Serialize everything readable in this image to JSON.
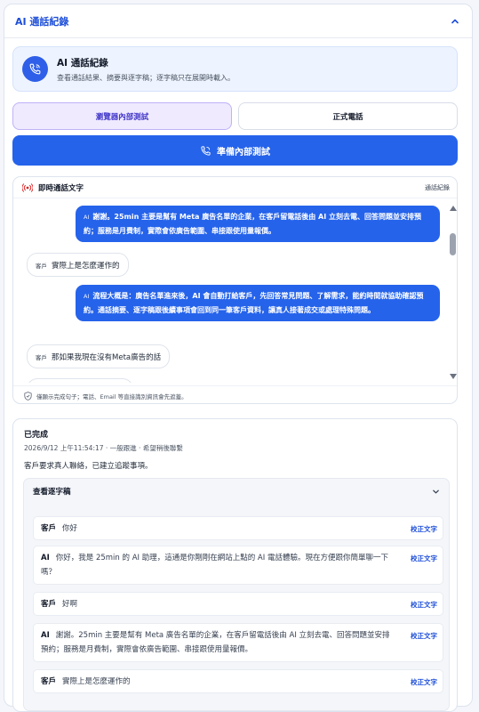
{
  "panel": {
    "title": "AI 通話紀錄"
  },
  "info": {
    "title": "AI 通話紀錄",
    "subtitle": "查看通話結果、摘要與逐字稿；逐字稿只在展開時載入。"
  },
  "modes": {
    "browser": "瀏覽器內部測試",
    "phone": "正式電話"
  },
  "primary_button": "準備內部測試",
  "live": {
    "title": "即時通話文字",
    "link": "通話紀錄",
    "footer": "僅顯示完成句子；電話、Email 等直接識別資訊會先遮蓋。",
    "messages": [
      {
        "role": "ai",
        "tag": "AI",
        "text": "謝謝。25min 主要是幫有 Meta 廣告名單的企業，在客戶留電話後由 AI 立刻去電、回答問題並安排預約；服務是月費制，實際會依廣告範圍、串接跟使用量報價。"
      },
      {
        "role": "user",
        "tag": "客戶",
        "text": "實際上是怎麼運作的"
      },
      {
        "role": "ai",
        "tag": "AI",
        "text": "流程大概是：廣告名單進來後，AI 會自動打給客戶，先回答常見問題、了解需求，能約時間就協助確認預約。通話摘要、逐字稿跟後續事項會回到同一筆客戶資料，讓真人接著成交或處理特殊問題。"
      },
      {
        "role": "user",
        "tag": "客戶",
        "text": "那如果我現在沒有Meta廣告的話"
      }
    ]
  },
  "result": {
    "status": "已完成",
    "meta": "2026/9/12 上午11:54:17 · 一般跟進 · 希望稍後聯繫",
    "summary": "客戶要求真人聯絡，已建立追蹤事項。",
    "transcript_label": "查看逐字稿",
    "fix_label": "校正文字",
    "rows": [
      {
        "who": "客戶",
        "text": "你好"
      },
      {
        "who": "AI",
        "text": "你好，我是 25min 的 AI 助理，這通是你剛剛在網站上點的 AI 電話體驗。現在方便跟你簡單聊一下嗎？"
      },
      {
        "who": "客戶",
        "text": "好啊"
      },
      {
        "who": "AI",
        "text": "謝謝。25min 主要是幫有 Meta 廣告名單的企業，在客戶留電話後由 AI 立刻去電、回答問題並安排預約；服務是月費制，實際會依廣告範圍、串接跟使用量報價。"
      },
      {
        "who": "客戶",
        "text": "實際上是怎麼運作的"
      }
    ]
  },
  "colors": {
    "accent": "#2563eb",
    "brand_title": "#1d4ed8",
    "active_tab_bg": "#efeafe",
    "live_icon": "#dc2626"
  }
}
